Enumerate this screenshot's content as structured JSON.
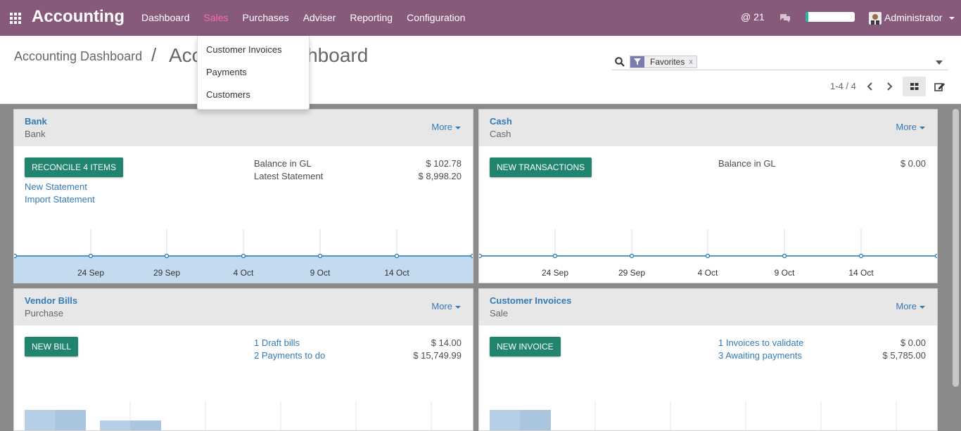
{
  "app": {
    "title": "Accounting"
  },
  "navbar": {
    "menu": [
      "Dashboard",
      "Sales",
      "Purchases",
      "Adviser",
      "Reporting",
      "Configuration"
    ],
    "active_menu": "Sales",
    "mentions_label": "@ 21",
    "progress": 0.05,
    "user": "Administrator"
  },
  "sales_dropdown": [
    "Customer Invoices",
    "Payments",
    "Customers"
  ],
  "breadcrumb": {
    "parent": "Accounting Dashboard",
    "separator": "/",
    "current": "Accounting Dashboard"
  },
  "search": {
    "facet": "Favorites",
    "facet_remove": "x"
  },
  "pager": {
    "text": "1-4 / 4"
  },
  "colors": {
    "navbar": "#875a7b",
    "active_menu": "#f56fa1",
    "primary_button": "#21846f",
    "link": "#337ab7"
  },
  "cards": {
    "bank": {
      "title": "Bank",
      "subtitle": "Bank",
      "more": "More",
      "button": "RECONCILE 4 ITEMS",
      "links": [
        "New Statement",
        "Import Statement"
      ],
      "rows": [
        {
          "label": "Balance in GL",
          "value": "$ 102.78"
        },
        {
          "label": "Latest Statement",
          "value": "$ 8,998.20"
        }
      ],
      "axis": [
        "24 Sep",
        "29 Sep",
        "4 Oct",
        "9 Oct",
        "14 Oct"
      ]
    },
    "cash": {
      "title": "Cash",
      "subtitle": "Cash",
      "more": "More",
      "button": "NEW TRANSACTIONS",
      "rows": [
        {
          "label": "Balance in GL",
          "value": "$ 0.00"
        }
      ],
      "axis": [
        "24 Sep",
        "29 Sep",
        "4 Oct",
        "9 Oct",
        "14 Oct"
      ]
    },
    "vendor": {
      "title": "Vendor Bills",
      "subtitle": "Purchase",
      "more": "More",
      "button": "NEW BILL",
      "rows": [
        {
          "label": "1 Draft bills",
          "value": "$ 14.00"
        },
        {
          "label": "2 Payments to do",
          "value": "$ 15,749.99"
        }
      ]
    },
    "customer": {
      "title": "Customer Invoices",
      "subtitle": "Sale",
      "more": "More",
      "button": "NEW INVOICE",
      "rows": [
        {
          "label": "1 Invoices to validate",
          "value": "$ 0.00"
        },
        {
          "label": "3 Awaiting payments",
          "value": "$ 5,785.00"
        }
      ]
    }
  }
}
